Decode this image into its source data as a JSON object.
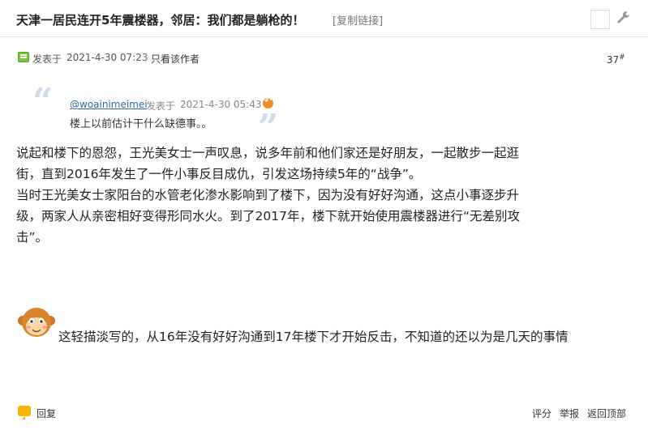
{
  "thread": {
    "title": "天津一居民连开5年震楼器，邻居：我们都是躺枪的！",
    "copy_link": "[复制链接]"
  },
  "post": {
    "posted_label": "发表于",
    "posted_time": "2021-4-30 07:23",
    "divider": "|",
    "author_only": "只看该作者",
    "floor": "37",
    "floor_mark": "#"
  },
  "quote": {
    "user": "@woainimeimei",
    "posted_label": "发表于",
    "posted_time": "2021-4-30 05:43",
    "text": "楼上以前估计干什么缺德事。。",
    "open_mark": "“",
    "close_mark": "”"
  },
  "body": {
    "lines": [
      "说起和楼下的恩怨，王光美女士一声叹息，说多年前和他们家还是好朋友，一起散步一起逛",
      "街，直到2016年发生了一件小事反目成仇，引发这场持续5年的“战争”。",
      "当时王光美女士家阳台的水管老化渗水影响到了楼下，因为没有好好沟通，这点小事逐步升",
      "级，两家人从亲密相好变得形同水火。到了2017年，楼下就开始使用震楼器进行“无差别攻",
      "击”。"
    ],
    "second": "这轻描淡写的，从16年没有好好沟通到17年楼下才开始反击，不知道的还以为是几天的事情"
  },
  "footer": {
    "reply": "回复",
    "rate": "评分",
    "report": "举报",
    "back_top": "返回顶部"
  },
  "icons": {
    "post": "post-icon",
    "wrench": "wrench-icon",
    "quote_back": "back-arrow-icon",
    "emoticon": "monkey-emoticon-icon",
    "reply": "reply-bubble-icon"
  },
  "colors": {
    "link": "#336699",
    "quote_mark": "#cfdbe7",
    "post_icon": "#7cc241",
    "reply_icon": "#f5b400"
  }
}
